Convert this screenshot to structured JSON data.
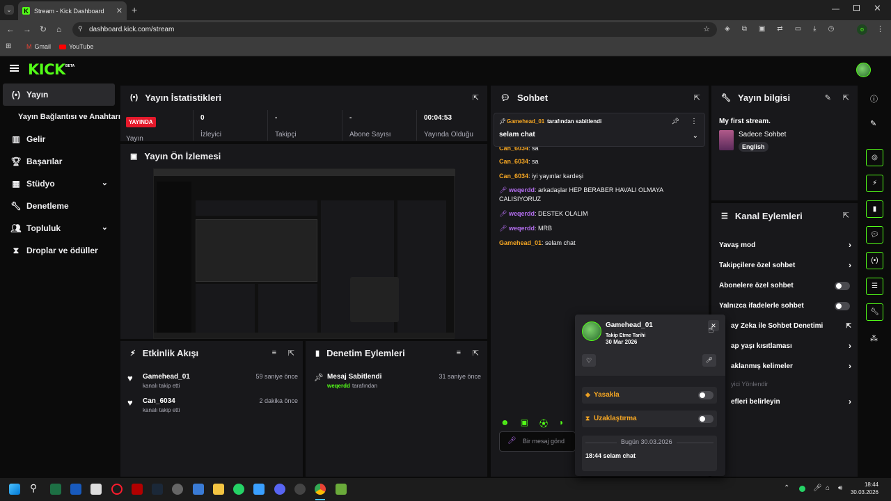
{
  "browser": {
    "tab_title": "Stream - Kick Dashboard",
    "tab_close": "✕",
    "new_tab": "+",
    "url": "dashboard.kick.com/stream",
    "bookmarks": [
      "Gmail",
      "YouTube"
    ],
    "profile_initial": "o"
  },
  "app": {
    "logo": "KICK",
    "logo_beta": "BETA"
  },
  "sidebar": {
    "items": [
      {
        "label": "Yayın",
        "icon": "broadcast-icon"
      },
      {
        "label": "Yayın Bağlantısı ve Anahtarı"
      },
      {
        "label": "Gelir",
        "icon": "chart-icon"
      },
      {
        "label": "Başarılar",
        "icon": "trophy-icon"
      },
      {
        "label": "Stüdyo",
        "icon": "studio-icon"
      },
      {
        "label": "Denetleme",
        "icon": "wrench-icon"
      },
      {
        "label": "Topluluk",
        "icon": "community-icon"
      },
      {
        "label": "Droplar ve ödüller",
        "icon": "gift-icon"
      }
    ]
  },
  "stats": {
    "title": "Yayın İstatistikleri",
    "live_badge": "YAYINDA",
    "live_label": "Yayın",
    "viewers_value": "0",
    "viewers_label": "İzleyici",
    "followers_value": "-",
    "followers_label": "Takipçi",
    "subs_value": "-",
    "subs_label": "Abone Sayısı",
    "uptime_value": "00:04:53",
    "uptime_label": "Yayında Olduğu"
  },
  "preview": {
    "title": "Yayın Ön İzlemesi"
  },
  "activity": {
    "title": "Etkinlik Akışı",
    "items": [
      {
        "user": "Gamehead_01",
        "action": "kanalı takip etti",
        "time": "59 saniye önce"
      },
      {
        "user": "Can_6034",
        "action": "kanalı takip etti",
        "time": "2 dakika önce"
      }
    ]
  },
  "moderation": {
    "title": "Denetim Eylemleri",
    "items": [
      {
        "title": "Mesaj Sabitlendi",
        "user": "weqerdd",
        "suffix": "tarafından",
        "time": "31 saniye önce"
      }
    ]
  },
  "chat": {
    "title": "Sohbet",
    "pinned_by_user": "Gamehead_01",
    "pinned_by_text": "tarafından sabitlendi",
    "pinned_message": "selam chat",
    "messages": [
      {
        "user": "Can_6034",
        "text": ": sa",
        "color": "gold"
      },
      {
        "user": "Can_6034",
        "text": ": sa",
        "color": "gold"
      },
      {
        "user": "Can_6034",
        "text": ": iyi yayınlar kardeşi",
        "color": "gold"
      },
      {
        "user": "weqerdd",
        "text": ": arkadaşlar HEP BERABER HAVALI OLMAYA CALISIYORUZ",
        "color": "purple"
      },
      {
        "user": "weqerdd",
        "text": ": DESTEK OLALIM",
        "color": "purple"
      },
      {
        "user": "weqerdd",
        "text": ": MRB",
        "color": "purple"
      },
      {
        "user": "Gamehead_01",
        "text": ": selam chat",
        "color": "gold"
      }
    ],
    "input_placeholder": "Bir mesaj gönd"
  },
  "user_card": {
    "username": "Gamehead_01",
    "follow_label": "Takip Etme Tarihi",
    "follow_date": "30 Mar 2026",
    "ban_label": "Yasakla",
    "timeout_label": "Uzaklaştırma",
    "date_divider": "Bugün 30.03.2026",
    "last_message": "18:44 selam chat"
  },
  "stream_info": {
    "title": "Yayın bilgisi",
    "stream_title": "My first stream.",
    "category": "Sadece Sohbet",
    "language": "English"
  },
  "channel_actions": {
    "title": "Kanal Eylemleri",
    "items": [
      {
        "label": "Yavaş mod",
        "type": "arrow"
      },
      {
        "label": "Takipçilere özel sohbet",
        "type": "arrow"
      },
      {
        "label": "Abonelere özel sohbet",
        "type": "toggle"
      },
      {
        "label": "Yalnızca ifadelerle sohbet",
        "type": "toggle"
      },
      {
        "label": "ay Zeka ile Sohbet Denetimi",
        "type": "external"
      },
      {
        "label": "ap yaşı kısıtlaması",
        "type": "arrow"
      },
      {
        "label": "aklanmış kelimeler",
        "type": "arrow"
      },
      {
        "label": "yici Yönlendir",
        "type": "none"
      },
      {
        "label": "efleri belirleyin",
        "type": "arrow"
      }
    ]
  },
  "taskbar": {
    "time": "18:44",
    "date": "30.03.2026"
  }
}
